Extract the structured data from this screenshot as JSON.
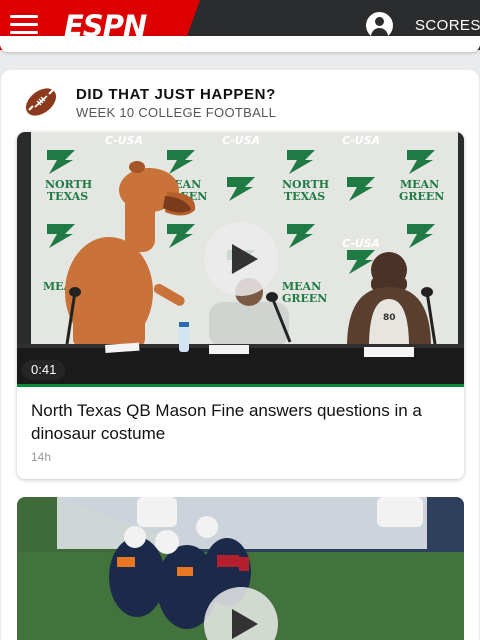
{
  "header": {
    "logo_text": "ESPN",
    "menu_icon": "hamburger-menu-icon",
    "account_icon": "user-account-icon",
    "scores_label": "SCORES",
    "brand_color": "#dd0000",
    "bar_color": "#2b2c2d"
  },
  "section": {
    "icon": "football-icon",
    "title": "DID THAT JUST HAPPEN?",
    "subtitle": "WEEK 10 COLLEGE FOOTBALL"
  },
  "stories": [
    {
      "duration": "0:41",
      "title": "North Texas QB Mason Fine answers questions in a dinosaur costume",
      "age": "14h",
      "backdrop_logos": [
        "C-USA",
        "NORTH TEXAS",
        "MEAN GREEN"
      ],
      "jersey_number": "80"
    },
    {
      "play_icon": "play-icon"
    }
  ]
}
